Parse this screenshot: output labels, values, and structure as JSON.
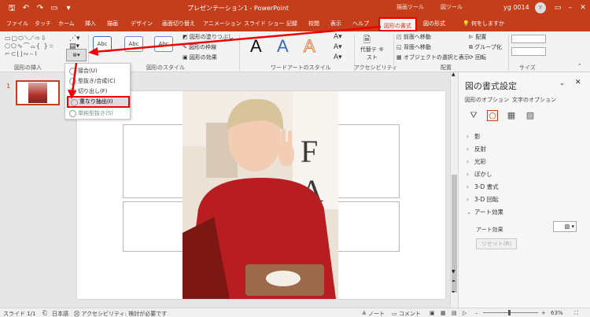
{
  "window": {
    "title": "プレゼンテーション1 - PowerPoint",
    "context_group_drawing": "描画ツール",
    "context_group_picture": "図ツール",
    "user": "yg 0014",
    "avatar_letter": "Y"
  },
  "tabs": [
    {
      "label": "ファイル"
    },
    {
      "label": "タッチ"
    },
    {
      "label": "ホーム"
    },
    {
      "label": "挿入"
    },
    {
      "label": "描画"
    },
    {
      "label": "デザイン"
    },
    {
      "label": "画面切り替え"
    },
    {
      "label": "アニメーション"
    },
    {
      "label": "スライド ショー"
    },
    {
      "label": "記録"
    },
    {
      "label": "校閲"
    },
    {
      "label": "表示"
    },
    {
      "label": "ヘルプ"
    },
    {
      "label": "図形の書式"
    },
    {
      "label": "図の形式"
    }
  ],
  "tell_me": "何をしますか",
  "ribbon": {
    "groups": {
      "insert_shapes": "図形の挿入",
      "shape_styles": "図形のスタイル",
      "wordart_styles": "ワードアートのスタイル",
      "accessibility": "アクセシビリティ",
      "arrange": "配置",
      "size": "サイズ"
    },
    "style_samples": [
      "Abc",
      "Abc",
      "Abc"
    ],
    "shape_fill": "図形の塗りつぶし",
    "shape_outline": "図形の枠線",
    "shape_effects": "図形の効果",
    "wordart_letter": "A",
    "alt_text": "代替テ キスト",
    "bring_forward": "前面へ移動",
    "send_backward": "背面へ移動",
    "selection_pane": "オブジェクトの選択と表示",
    "align": "配置",
    "group": "グループ化",
    "rotate": "回転"
  },
  "merge_menu": {
    "items": [
      {
        "label": "接合(U)",
        "state": "normal"
      },
      {
        "label": "型抜き/合成(C)",
        "state": "normal"
      },
      {
        "label": "切り出し(F)",
        "state": "normal"
      },
      {
        "label": "重なり抽出(I)",
        "state": "highlighted"
      },
      {
        "label": "単純型抜き(S)",
        "state": "dim"
      }
    ]
  },
  "thumbnail": {
    "number": "1"
  },
  "format_pane": {
    "title": "図の書式設定",
    "tab_shape": "図形のオプション",
    "tab_text": "文字のオプション",
    "sections": [
      "影",
      "反射",
      "光彩",
      "ぼかし",
      "3-D 書式",
      "3-D 回転",
      "アート効果"
    ],
    "art_effect_label": "アート効果",
    "reset_label": "リセット(R)"
  },
  "status": {
    "slide": "スライド 1/1",
    "language": "日本語",
    "accessibility": "アクセシビリティ: 検討が必要です",
    "notes": "ノート",
    "comments": "コメント",
    "zoom": "63%"
  },
  "colors": {
    "accent": "#c43e1c",
    "annotation": "#e00000"
  }
}
